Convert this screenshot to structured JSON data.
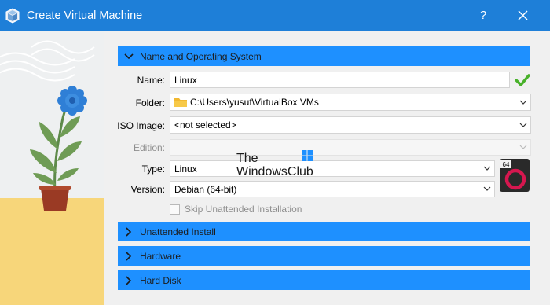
{
  "window": {
    "title": "Create Virtual Machine",
    "help_label": "?"
  },
  "sections": {
    "name_os": "Name and Operating System",
    "unattended": "Unattended Install",
    "hardware": "Hardware",
    "hard_disk": "Hard Disk"
  },
  "form": {
    "name_label": "Name:",
    "name_value": "Linux",
    "folder_label": "Folder:",
    "folder_value": "C:\\Users\\yusuf\\VirtualBox VMs",
    "iso_label": "ISO Image:",
    "iso_value": "<not selected>",
    "edition_label": "Edition:",
    "edition_value": "",
    "type_label": "Type:",
    "type_value": "Linux",
    "version_label": "Version:",
    "version_value": "Debian (64-bit)",
    "skip_label": "Skip Unattended Installation",
    "os_badge_text": "64"
  },
  "watermark": {
    "line1": "The",
    "line2": "WindowsClub"
  },
  "colors": {
    "titlebar": "#1e7fd8",
    "section_header": "#1e90ff",
    "illustration_bg": "#f0f2f3",
    "illustration_floor": "#f7d67a"
  }
}
